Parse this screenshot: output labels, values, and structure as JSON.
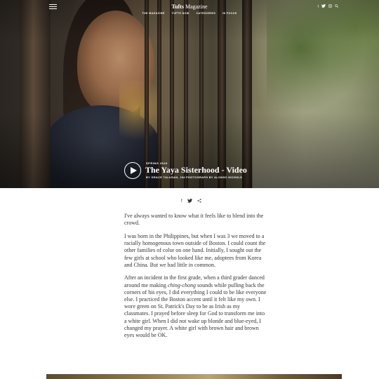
{
  "header": {
    "logo_bold": "Tufts",
    "logo_rest": " Magazine",
    "nav": [
      "THE MAGAZINE",
      "TUFTS NOW",
      "CATEGORIES",
      "IN FOCUS"
    ],
    "social": [
      "f",
      "t",
      "ig",
      "search"
    ]
  },
  "hero": {
    "issue": "SPRING 2016",
    "title": "The Yaya Sisterhood - Video",
    "byline": "BY GRACE TALUSAN, J94   PHOTOGRAPH BY ALONSO NICHOLS"
  },
  "share": [
    "f",
    "t",
    "share"
  ],
  "article": {
    "p1": "I've always wanted to know what it feels like to blend into the crowd.",
    "p2": "I was born in the Philippines, but when I was 3 we moved to a racially homogenous town outside of Boston. I could count the other families of color on one hand. Initially, I sought out the few girls at school who looked like me, adoptees from Korea and China. But we had little in common.",
    "p3_a": "After an incident in the first grade, when a third grader danced around me making ",
    "p3_em": "ching-chong",
    "p3_b": " sounds while pulling back the corners of his eyes, I did everything I could to be like everyone else. I practiced the Boston accent until it felt like my own. I wore green on St. Patrick's Day to be as Irish as my classmates. I prayed before sleep for God to transform me into a white girl. When I did not wake up blonde and blue-eyed, I changed my prayer. A white girl with brown hair and brown eyes would be OK."
  }
}
